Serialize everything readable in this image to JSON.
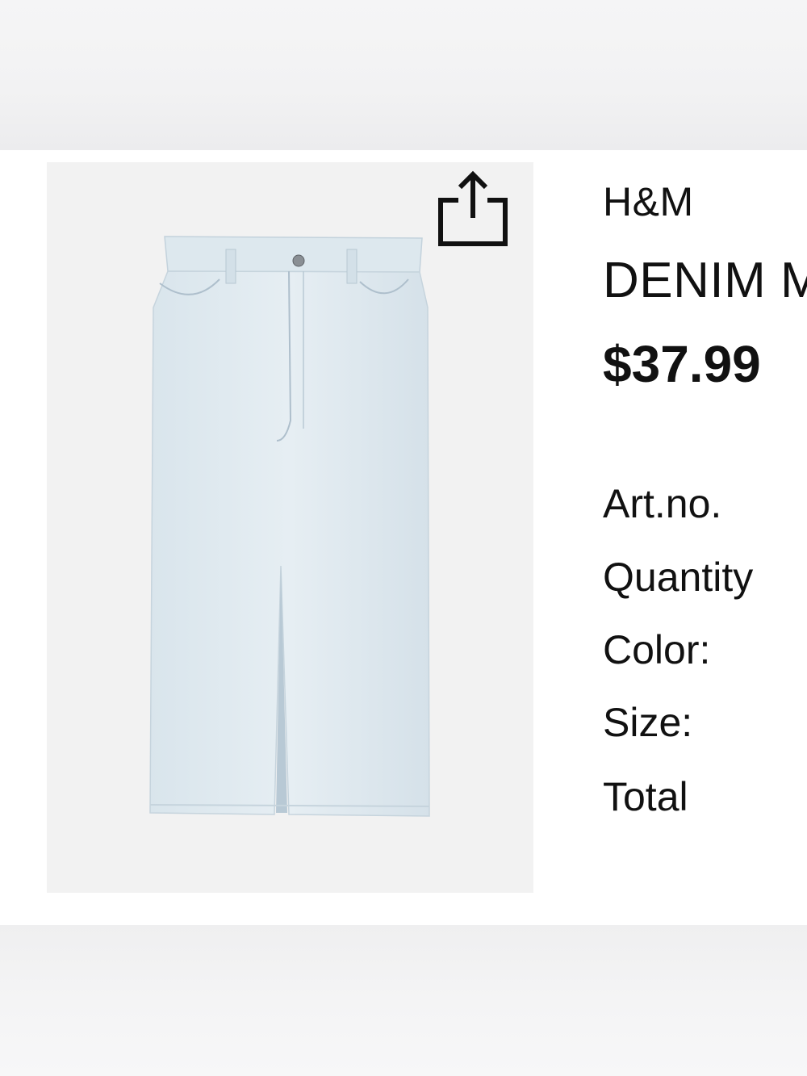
{
  "product": {
    "brand": "H&M",
    "name": "DENIM M",
    "price": "$37.99",
    "image_icon": "denim-skirt-image"
  },
  "details": {
    "art_no_label": "Art.no.",
    "quantity_label": "Quantity",
    "color_label": "Color:",
    "size_label": "Size:",
    "total_label": "Total"
  },
  "actions": {
    "share_icon": "share-icon"
  },
  "colors": {
    "denim": "#dfe9ef",
    "image_background": "#f2f2f2",
    "text": "#111111"
  }
}
